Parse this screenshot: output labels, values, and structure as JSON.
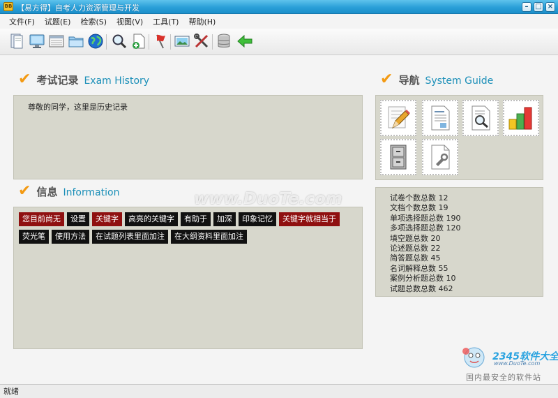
{
  "window": {
    "icon_text": "BB",
    "title": "【易方得】自考人力资源管理与开发",
    "controls": [
      "minimize",
      "maximize",
      "close"
    ]
  },
  "menu": [
    "文件(F)",
    "试题(E)",
    "检索(S)",
    "视图(V)",
    "工具(T)",
    "帮助(H)"
  ],
  "toolbar_icons": [
    "book-icon",
    "monitor-icon",
    "browser-window-icon",
    "folder-icon",
    "globe-icon",
    "magnifier-icon",
    "new-document-icon",
    "flag-icon",
    "image-icon",
    "tools-icon",
    "database-icon",
    "back-arrow-icon"
  ],
  "exam": {
    "title_cn": "考试记录",
    "title_en": "Exam History",
    "note": "尊敬的同学，这里是历史记录"
  },
  "info": {
    "title_cn": "信息",
    "title_en": "Information",
    "tags": [
      {
        "text": "您目前尚无",
        "color": "#8f1010"
      },
      {
        "text": "设置",
        "color": "#111111"
      },
      {
        "text": "关键字",
        "color": "#8f1010"
      },
      {
        "text": "高亮的关键字",
        "color": "#111111"
      },
      {
        "text": "有助于",
        "color": "#111111"
      },
      {
        "text": "加深",
        "color": "#111111"
      },
      {
        "text": "印象记忆",
        "color": "#111111"
      },
      {
        "text": "关键字就相当于",
        "color": "#8f1010"
      },
      {
        "text": "荧光笔",
        "color": "#111111"
      },
      {
        "text": "使用方法",
        "color": "#111111"
      },
      {
        "text": "在试题列表里面加注",
        "color": "#111111"
      },
      {
        "text": "在大纲资料里面加注",
        "color": "#111111"
      }
    ]
  },
  "guide": {
    "title_cn": "导航",
    "title_en": "System Guide",
    "items": [
      "edit-pencil-icon",
      "document-icon",
      "search-document-icon",
      "statistics-blocks-icon",
      "cabinet-icon",
      "settings-document-icon"
    ]
  },
  "stats": [
    {
      "label": "试卷个数总数",
      "value": "12"
    },
    {
      "label": "文档个数总数",
      "value": "19"
    },
    {
      "label": "单项选择题总数",
      "value": "190"
    },
    {
      "label": "多项选择题总数",
      "value": "120"
    },
    {
      "label": "填空题总数",
      "value": "20"
    },
    {
      "label": "论述题总数",
      "value": "22"
    },
    {
      "label": "简答题总数",
      "value": "45"
    },
    {
      "label": "名词解释总数",
      "value": "55"
    },
    {
      "label": "案例分析题总数",
      "value": "10"
    },
    {
      "label": "试题总数总数",
      "value": "462"
    }
  ],
  "status": "就绪",
  "watermark": {
    "main": "www.DuoTe.com",
    "brand": "2345软件大全",
    "url": "www.DuoTe.com",
    "slogan": "国内最安全的软件站"
  }
}
